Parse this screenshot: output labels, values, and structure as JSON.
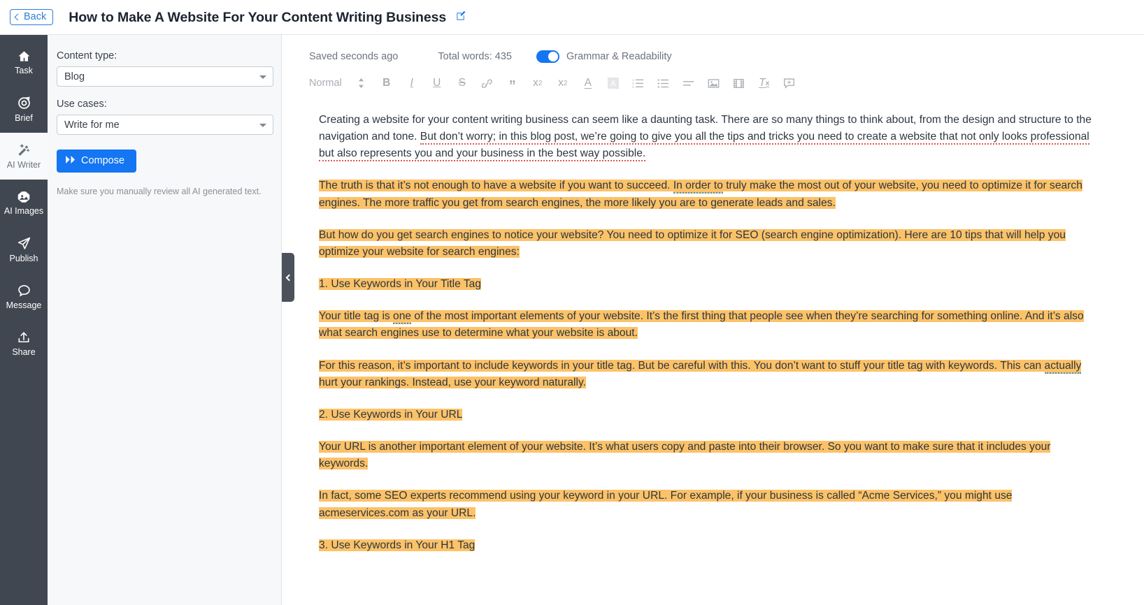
{
  "header": {
    "back_label": "Back",
    "title": "How to Make A Website For Your Content Writing Business",
    "edit_icon": "pencil-square-icon"
  },
  "rail": {
    "items": [
      {
        "label": "Task",
        "icon": "home-icon",
        "active": false
      },
      {
        "label": "Brief",
        "icon": "target-icon",
        "active": false
      },
      {
        "label": "AI Writer",
        "icon": "magic-wand-icon",
        "active": true
      },
      {
        "label": "AI Images",
        "icon": "image-icon",
        "active": false
      },
      {
        "label": "Publish",
        "icon": "paper-plane-icon",
        "active": false
      },
      {
        "label": "Message",
        "icon": "chat-bubble-icon",
        "active": false
      },
      {
        "label": "Share",
        "icon": "upload-icon",
        "active": false
      }
    ]
  },
  "panel": {
    "content_type_label": "Content type:",
    "content_type_value": "Blog",
    "use_cases_label": "Use cases:",
    "use_cases_value": "Write for me",
    "compose_label": "Compose",
    "compose_icon": "fast-forward-icon",
    "note": "Make sure you manually review all AI generated text."
  },
  "status": {
    "saved": "Saved seconds ago",
    "total_words": "Total words: 435",
    "grammar_toggle_label": "Grammar & Readability",
    "grammar_toggle_on": true,
    "accent_color": "#1476f2"
  },
  "toolbar": {
    "style_value": "Normal",
    "buttons": [
      {
        "name": "style-stepper-icon",
        "glyph": "↕"
      },
      {
        "name": "bold-icon",
        "glyph": "B"
      },
      {
        "name": "italic-icon",
        "glyph": "I"
      },
      {
        "name": "underline-icon",
        "glyph": "U"
      },
      {
        "name": "strikethrough-icon",
        "glyph": "S"
      },
      {
        "name": "link-icon",
        "glyph": "🔗"
      },
      {
        "name": "blockquote-icon",
        "glyph": "”"
      },
      {
        "name": "subscript-icon",
        "glyph": "x₂"
      },
      {
        "name": "superscript-icon",
        "glyph": "x²"
      },
      {
        "name": "text-color-icon",
        "glyph": "A"
      },
      {
        "name": "highlight-color-icon",
        "glyph": "A"
      },
      {
        "name": "ordered-list-icon",
        "glyph": ""
      },
      {
        "name": "bullet-list-icon",
        "glyph": ""
      },
      {
        "name": "align-icon",
        "glyph": ""
      },
      {
        "name": "insert-image-icon",
        "glyph": ""
      },
      {
        "name": "insert-video-icon",
        "glyph": ""
      },
      {
        "name": "clear-formatting-icon",
        "glyph": ""
      },
      {
        "name": "comment-icon",
        "glyph": ""
      }
    ]
  },
  "document": {
    "paragraphs": [
      {
        "id": "p1",
        "highlighted": false,
        "runs": [
          {
            "text": "Creating a website for your content writing business can seem like a daunting task. There are so many things to think about, from the design and structure to the navigation and tone. ",
            "mark": "none"
          },
          {
            "text": "But don’t worry; in this blog post, we’re going to give you all the tips and tricks you need to create a website that not only looks professional but also represents you and your business in the best way possible.",
            "mark": "grammar"
          }
        ]
      },
      {
        "id": "p2",
        "highlighted": true,
        "runs": [
          {
            "text": "The truth is that it’s not enough to have a website if you want to succeed. ",
            "mark": "none"
          },
          {
            "text": "In order to",
            "mark": "readability"
          },
          {
            "text": " truly make the most out of your website, you need to optimize it for search engines. The more traffic you get from search engines, the more likely you are to generate leads and sales.",
            "mark": "none"
          }
        ]
      },
      {
        "id": "p3",
        "highlighted": true,
        "runs": [
          {
            "text": "But how do you get search engines to notice your website? You need to optimize it for SEO (search engine optimization). Here are 10 tips that will help you optimize your website for search engines:",
            "mark": "none"
          }
        ]
      },
      {
        "id": "p4",
        "highlighted": true,
        "runs": [
          {
            "text": "1. Use Keywords in Your Title Tag",
            "mark": "none"
          }
        ]
      },
      {
        "id": "p5",
        "highlighted": true,
        "runs": [
          {
            "text": "Your title tag is ",
            "mark": "none"
          },
          {
            "text": "one",
            "mark": "readability"
          },
          {
            "text": " of the most important elements of your website. It’s the first thing that people see when they’re searching for something online. And it’s also what search engines use to determine what your website is about.",
            "mark": "none"
          }
        ]
      },
      {
        "id": "p6",
        "highlighted": true,
        "runs": [
          {
            "text": "For this reason, it’s important to include keywords in your title tag. But be careful with this. You don’t want to stuff your title tag with keywords. This can ",
            "mark": "none"
          },
          {
            "text": "actually",
            "mark": "readability"
          },
          {
            "text": " hurt your rankings. Instead, use your keyword naturally.",
            "mark": "none"
          }
        ]
      },
      {
        "id": "p7",
        "highlighted": true,
        "runs": [
          {
            "text": "2. Use Keywords in Your URL",
            "mark": "none"
          }
        ]
      },
      {
        "id": "p8",
        "highlighted": true,
        "runs": [
          {
            "text": "Your URL is another important element of your website. It’s what users copy and paste into their browser. So you want to make sure that it includes your keywords.",
            "mark": "none"
          }
        ]
      },
      {
        "id": "p9",
        "highlighted": true,
        "runs": [
          {
            "text": "In fact, some SEO experts recommend using your keyword in your URL. For example, if your business is called “Acme Services,” you might use acmeservices.com as your URL.",
            "mark": "none"
          }
        ]
      },
      {
        "id": "p10",
        "highlighted": true,
        "runs": [
          {
            "text": "3. Use Keywords in Your H1 Tag",
            "mark": "none"
          }
        ]
      }
    ],
    "highlight_color": "#fcc268",
    "grammar_underline_color": "#e0544f",
    "readability_underline_color": "#3a9ad9"
  },
  "collapse_handle": {
    "icon": "chevron-left-icon"
  }
}
